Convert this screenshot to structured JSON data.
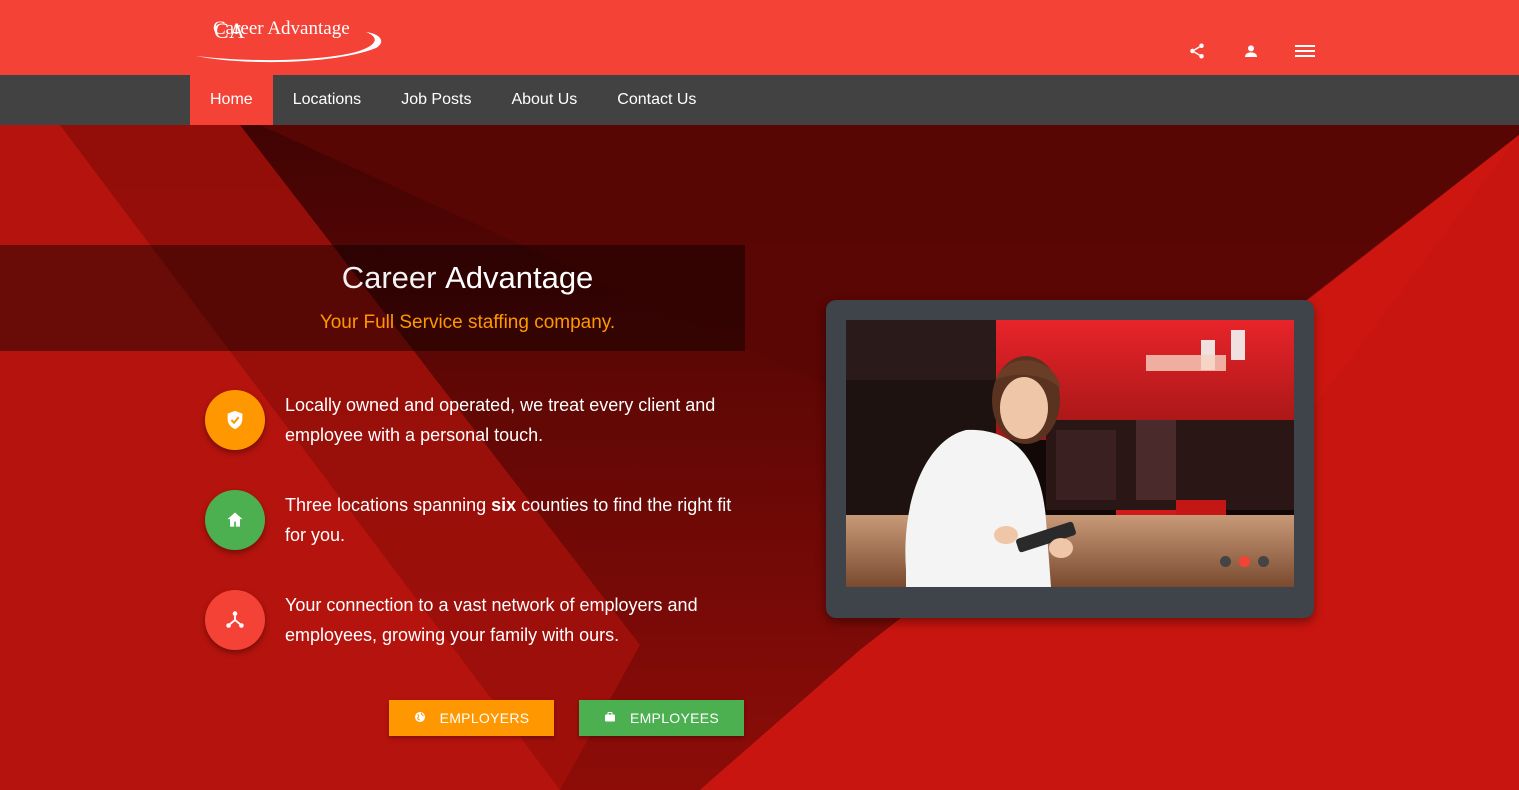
{
  "brand": {
    "logo_monogram": "CA",
    "logo_text": "Career Advantage"
  },
  "header_icons": [
    "share-icon",
    "account-icon",
    "menu-icon"
  ],
  "nav": {
    "items": [
      {
        "label": "Home",
        "active": true
      },
      {
        "label": "Locations",
        "active": false
      },
      {
        "label": "Job Posts",
        "active": false
      },
      {
        "label": "About Us",
        "active": false
      },
      {
        "label": "Contact Us",
        "active": false
      }
    ]
  },
  "hero": {
    "title_light": "Career ",
    "title_strong": "Advantage",
    "subtitle": "Your Full Service staffing company."
  },
  "features": [
    {
      "icon": "shield-check-icon",
      "color": "#ff9800",
      "text": "Locally owned and operated, we treat every client and employee with a personal touch."
    },
    {
      "icon": "home-icon",
      "color": "#4caf50",
      "text_before": "Three locations spanning ",
      "text_bold": "six",
      "text_after": " counties to find the right fit for you."
    },
    {
      "icon": "network-icon",
      "color": "#f44336",
      "text": "Your connection to a vast network of employers and employees, growing your family with ours."
    }
  ],
  "buttons": {
    "employers": {
      "label": "EMPLOYERS",
      "icon": "globe-icon",
      "color": "#ff9800"
    },
    "employees": {
      "label": "EMPLOYEES",
      "icon": "briefcase-icon",
      "color": "#4caf50"
    }
  },
  "slider": {
    "slide_count": 3,
    "active_index": 1
  },
  "colors": {
    "primary": "#f44336",
    "nav_bg": "#424242",
    "hero_red": "#c9150f"
  }
}
